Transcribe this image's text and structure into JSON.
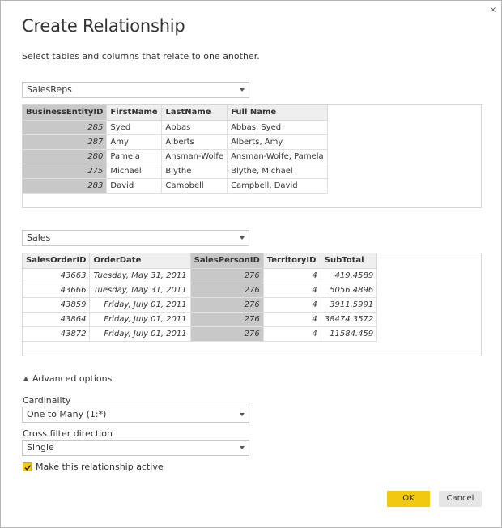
{
  "dialog": {
    "title": "Create Relationship",
    "subtitle": "Select tables and columns that relate to one another.",
    "close_glyph": "×"
  },
  "table1": {
    "selected": "SalesReps",
    "columns": [
      "BusinessEntityID",
      "FirstName",
      "LastName",
      "Full Name"
    ],
    "rows": [
      [
        "285",
        "Syed",
        "Abbas",
        "Abbas, Syed"
      ],
      [
        "287",
        "Amy",
        "Alberts",
        "Alberts, Amy"
      ],
      [
        "280",
        "Pamela",
        "Ansman-Wolfe",
        "Ansman-Wolfe, Pamela"
      ],
      [
        "275",
        "Michael",
        "Blythe",
        "Blythe, Michael"
      ],
      [
        "283",
        "David",
        "Campbell",
        "Campbell, David"
      ]
    ]
  },
  "table2": {
    "selected": "Sales",
    "columns": [
      "SalesOrderID",
      "OrderDate",
      "SalesPersonID",
      "TerritoryID",
      "SubTotal"
    ],
    "rows": [
      [
        "43663",
        "Tuesday, May 31, 2011",
        "276",
        "4",
        "419.4589"
      ],
      [
        "43666",
        "Tuesday, May 31, 2011",
        "276",
        "4",
        "5056.4896"
      ],
      [
        "43859",
        "Friday, July 01, 2011",
        "276",
        "4",
        "3911.5991"
      ],
      [
        "43864",
        "Friday, July 01, 2011",
        "276",
        "4",
        "38474.3572"
      ],
      [
        "43872",
        "Friday, July 01, 2011",
        "276",
        "4",
        "11584.459"
      ]
    ]
  },
  "advanced": {
    "toggle_label": "Advanced options",
    "cardinality_label": "Cardinality",
    "cardinality_value": "One to Many (1:*)",
    "cross_filter_label": "Cross filter direction",
    "cross_filter_value": "Single",
    "active_label": "Make this relationship active",
    "active_checked": true
  },
  "buttons": {
    "ok": "OK",
    "cancel": "Cancel"
  },
  "colors": {
    "accent": "#f2c811",
    "selected_column": "#c8c8c8"
  }
}
